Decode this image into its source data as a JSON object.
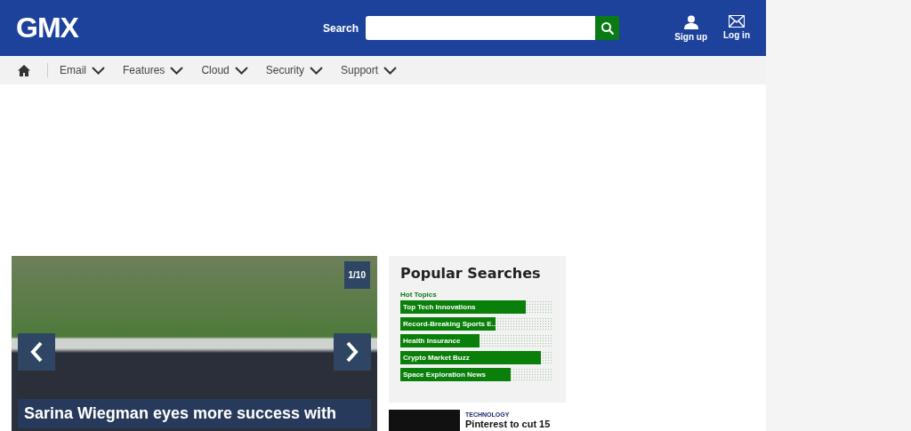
{
  "header": {
    "logo": "GMX",
    "search": {
      "label": "Search"
    },
    "actions": [
      {
        "kind": "user",
        "label": "Sign up"
      },
      {
        "kind": "mail",
        "label": "Log in"
      }
    ]
  },
  "nav": {
    "items": [
      {
        "label": "Email"
      },
      {
        "label": "Features"
      },
      {
        "label": "Cloud"
      },
      {
        "label": "Security"
      },
      {
        "label": "Support"
      }
    ]
  },
  "slider": {
    "counter": "1/10",
    "headline": "Sarina Wiegman eyes more success with"
  },
  "popular_searches": {
    "title": "Popular Searches",
    "subtitle": "Hot Topics",
    "items": [
      {
        "label": "Top Tech Innovations",
        "level": 0.82
      },
      {
        "label": "Record-Breaking Sports E...",
        "level": 0.62
      },
      {
        "label": "Health Insurance",
        "level": 0.52
      },
      {
        "label": "Crypto Market Buzz",
        "level": 0.92
      },
      {
        "label": "Space Exploration News",
        "level": 0.72
      }
    ]
  },
  "news": [
    {
      "category": "TECHNOLOGY",
      "title": "Pinterest to cut 15"
    }
  ]
}
